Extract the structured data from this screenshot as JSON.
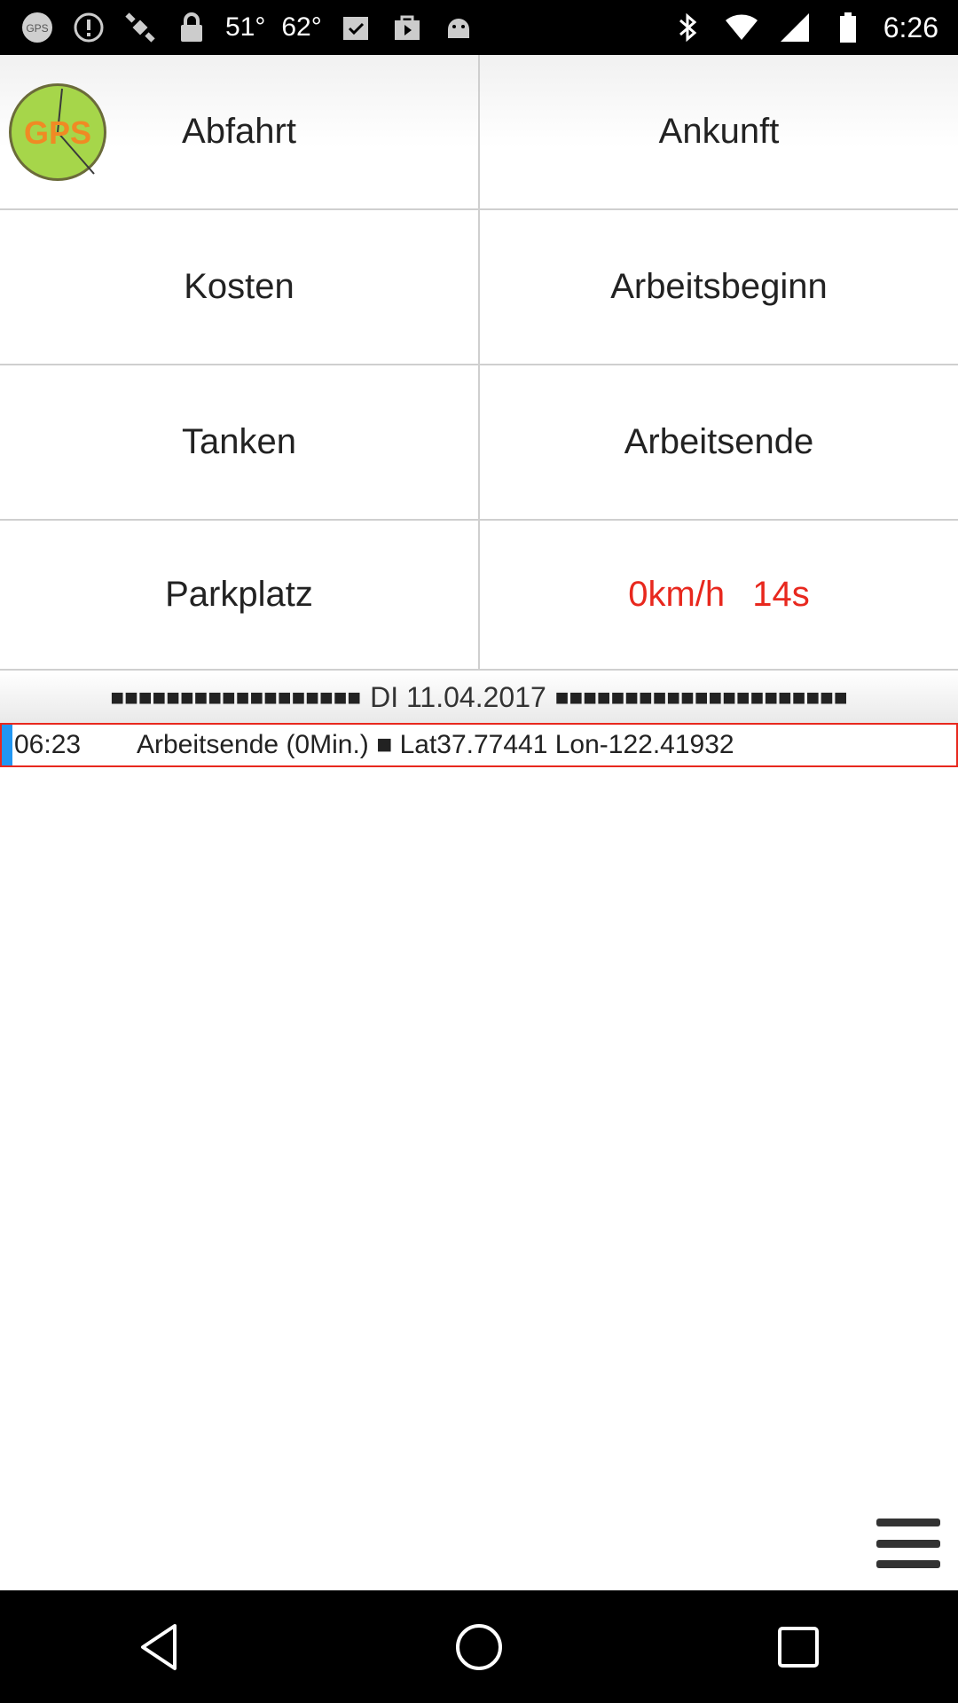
{
  "status_bar": {
    "temp1": "51°",
    "temp2": "62°",
    "time": "6:26",
    "icons": [
      "gps-app-icon",
      "alert-icon",
      "satellite-icon",
      "lock-icon",
      "clipboard-check-icon",
      "play-bag-icon",
      "android-icon",
      "bluetooth-icon",
      "wifi-icon",
      "cellular-icon",
      "battery-icon"
    ]
  },
  "buttons": {
    "abfahrt": "Abfahrt",
    "ankunft": "Ankunft",
    "kosten": "Kosten",
    "arbeitsbeginn": "Arbeitsbeginn",
    "tanken": "Tanken",
    "arbeitsende": "Arbeitsende",
    "parkplatz": "Parkplatz"
  },
  "speed": {
    "value": "0km/h",
    "duration": "14s",
    "color": "#e8281e"
  },
  "logo": {
    "text": "GPS"
  },
  "date_band": {
    "blocks_left": "■■■■■■■■■■■■■■■■■■",
    "date": "DI 11.04.2017",
    "blocks_right": "■■■■■■■■■■■■■■■■■■■■■"
  },
  "entry": {
    "time": "06:23",
    "text": "Arbeitsende (0Min.) ■ Lat37.77441 Lon-122.41932"
  },
  "colors": {
    "accent_red": "#e8281e",
    "marker_blue": "#2196f3",
    "logo_green": "#a6d64a",
    "logo_orange": "#f08a24"
  }
}
